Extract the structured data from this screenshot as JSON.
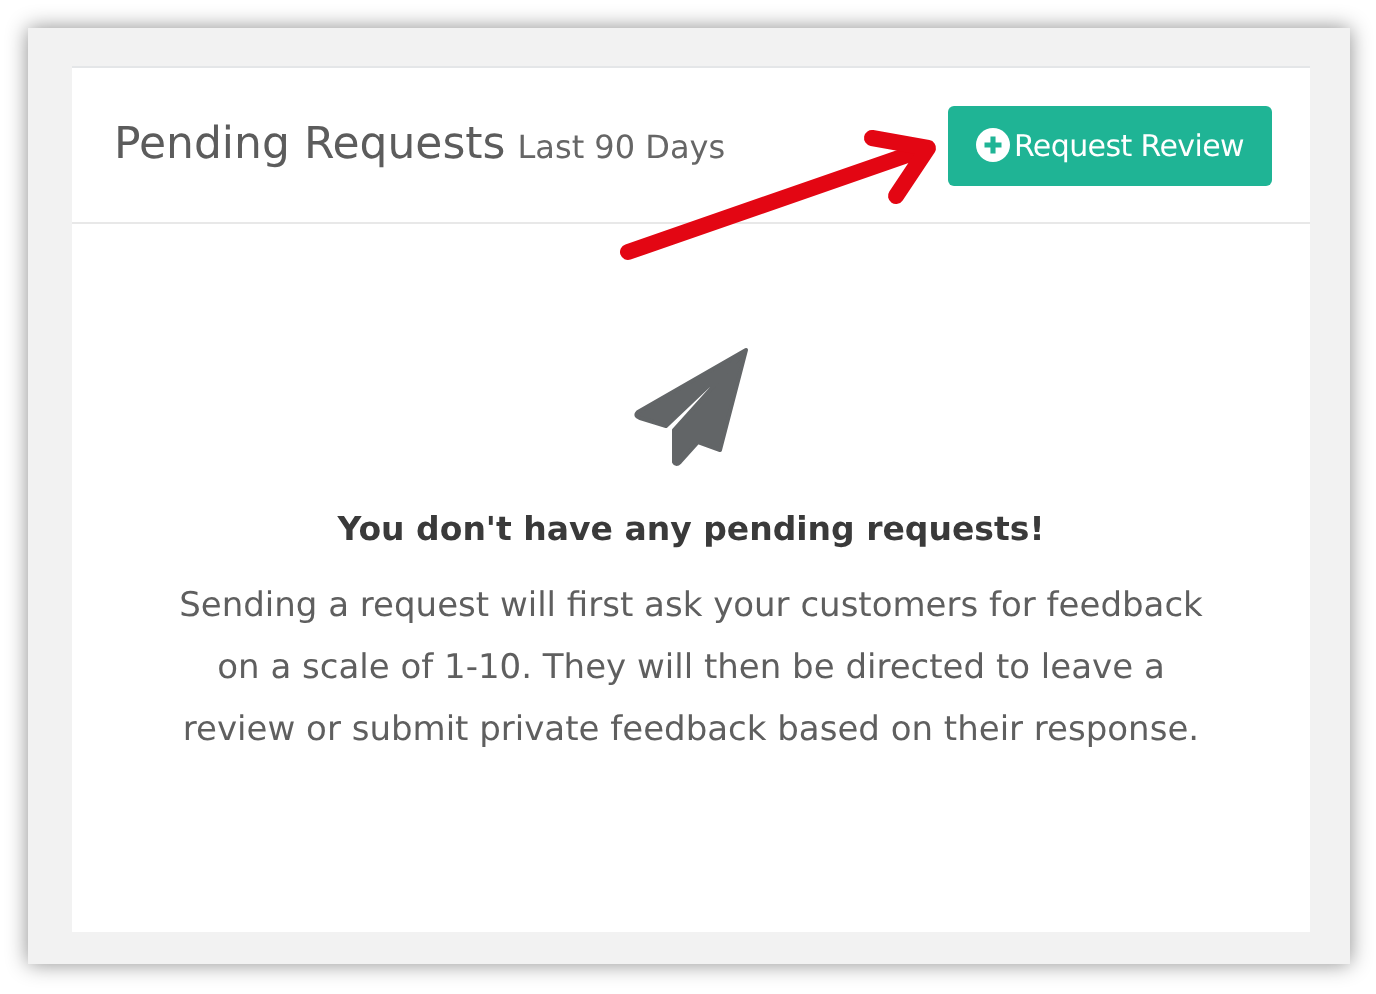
{
  "panel": {
    "title": "Pending Requests",
    "subtitle": "Last 90 Days",
    "button": {
      "label": "Request Review"
    }
  },
  "empty_state": {
    "heading": "You don't have any pending requests!",
    "message": "Sending a request will first ask your customers for feedback on a scale of 1-10. They will then be directed to leave a review or submit private feedback based on their response."
  }
}
